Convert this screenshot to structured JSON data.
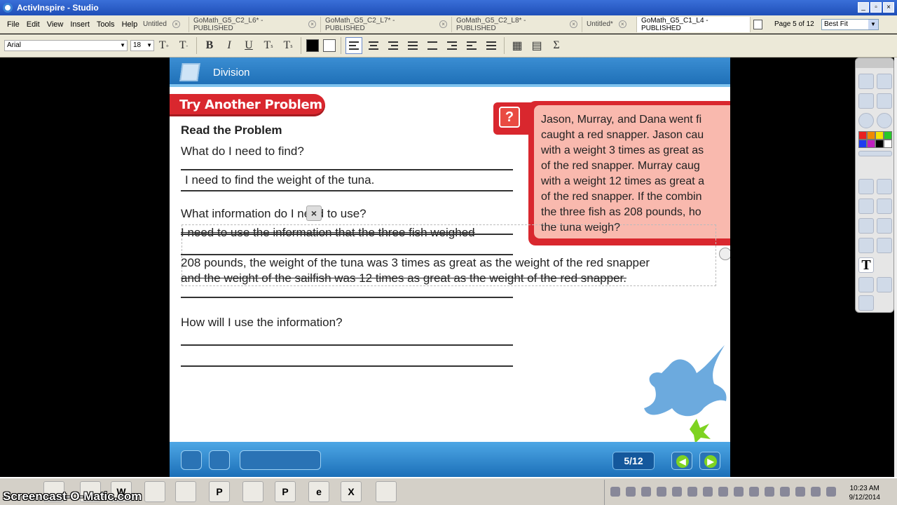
{
  "window": {
    "title": "ActivInspire - Studio",
    "controls": [
      "_",
      "▫",
      "×"
    ]
  },
  "menu": [
    "File",
    "Edit",
    "View",
    "Insert",
    "Tools",
    "Help"
  ],
  "tabs": [
    {
      "label": "Untitled"
    },
    {
      "label": "GoMath_G5_C2_L6* - PUBLISHED"
    },
    {
      "label": "GoMath_G5_C2_L7* - PUBLISHED"
    },
    {
      "label": "GoMath_G5_C2_L8* - PUBLISHED"
    },
    {
      "label": "Untitled*"
    },
    {
      "label": "GoMath_G5_C1_L4 - PUBLISHED"
    }
  ],
  "page_info": "Page 5 of 12",
  "zoom": "Best Fit",
  "format": {
    "font": "Arial",
    "size": "18"
  },
  "lesson": {
    "header_title": "Division",
    "banner": "Try Another Problem",
    "read_heading": "Read the Problem",
    "q1": "What do I need to find?",
    "a1": "I need to find the weight of the tuna.",
    "q2": "What information do I need to use?",
    "a2_line1": "I need to use the information that the three fish weighed",
    "a2_line2": "208 pounds, the weight of the tuna was 3 times as great as the weight of the red snapper",
    "a2_line3": "and the weight of the sailfish was 12 times as great as the weight of the red snapper.",
    "q3": "How will I use the information?",
    "problem_icon": "?",
    "problem_text": "Jason, Murray, and Dana went fi\ncaught a red snapper. Jason cau\nwith a weight 3 times as great as\nof the red snapper. Murray caug\nwith a weight 12 times as great a\nof the red snapper. If the combin\nthe three fish as 208 pounds, ho\nthe tuna weigh?",
    "page_badge": "5/12"
  },
  "taskbar": {
    "watermark": "Screencast-O-Matic.com",
    "time": "10:23 AM",
    "date": "9/12/2014"
  },
  "colors": {
    "accent_blue": "#1f70b7",
    "banner_red": "#d9272e",
    "problem_pink": "#f9b9ae",
    "nav_green": "#7ed321"
  }
}
